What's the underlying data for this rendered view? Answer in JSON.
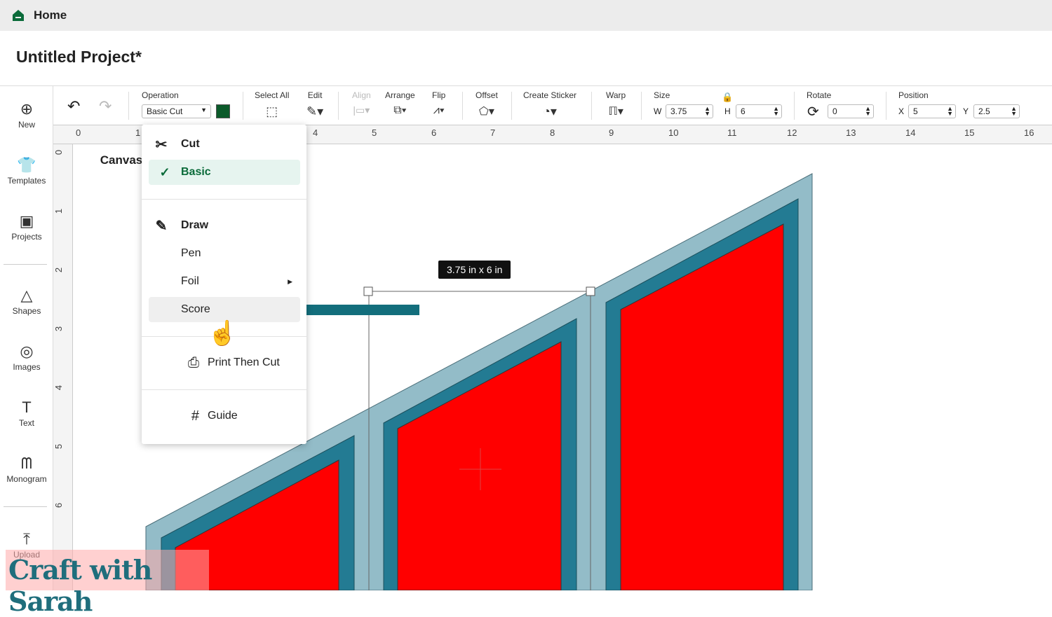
{
  "tabs": {
    "home": "Home",
    "canvas": "Canvas"
  },
  "project_title": "Untitled Project*",
  "sidebar": [
    {
      "label": "New",
      "icon": "plus-circle-icon",
      "glyph": "⊕"
    },
    {
      "label": "Templates",
      "icon": "shirt-icon",
      "glyph": "👕"
    },
    {
      "label": "Projects",
      "icon": "projects-icon",
      "glyph": "▣"
    },
    {
      "label": "Shapes",
      "icon": "shapes-icon",
      "glyph": "△"
    },
    {
      "label": "Images",
      "icon": "bulb-icon",
      "glyph": "◎"
    },
    {
      "label": "Text",
      "icon": "text-icon",
      "glyph": "T"
    },
    {
      "label": "Monogram",
      "icon": "monogram-icon",
      "glyph": "ᗰ"
    },
    {
      "label": "Upload",
      "icon": "upload-icon",
      "glyph": "⤒"
    }
  ],
  "toolbar": {
    "operation_label": "Operation",
    "operation_value": "Basic Cut",
    "operation_color": "#0b5a2a",
    "select_all": "Select All",
    "edit": "Edit",
    "align": "Align",
    "arrange": "Arrange",
    "flip": "Flip",
    "offset": "Offset",
    "create_sticker": "Create Sticker",
    "warp": "Warp",
    "size": "Size",
    "w_label": "W",
    "w_value": "3.75",
    "h_label": "H",
    "h_value": "6",
    "rotate": "Rotate",
    "rotate_value": "0",
    "position": "Position",
    "x_label": "X",
    "x_value": "5",
    "y_label": "Y",
    "y_value": "2.5"
  },
  "ruler_top": [
    "0",
    "1",
    "4",
    "5",
    "6",
    "7",
    "8",
    "9",
    "10",
    "11",
    "12",
    "13",
    "14",
    "15",
    "16"
  ],
  "ruler_left": [
    "0",
    "1",
    "2",
    "3",
    "4",
    "5",
    "6"
  ],
  "menu": {
    "cut": "Cut",
    "basic": "Basic",
    "draw": "Draw",
    "pen": "Pen",
    "foil": "Foil",
    "score": "Score",
    "print_then_cut": "Print Then Cut",
    "guide": "Guide"
  },
  "size_tooltip": "3.75  in x 6  in",
  "watermark": "Craft with Sarah",
  "colors": {
    "accent": "#0b6b3a",
    "arrow": "#136e7c",
    "panel_light": "#93bcc8",
    "panel_dark": "#237b93",
    "fill": "#ff0000"
  }
}
